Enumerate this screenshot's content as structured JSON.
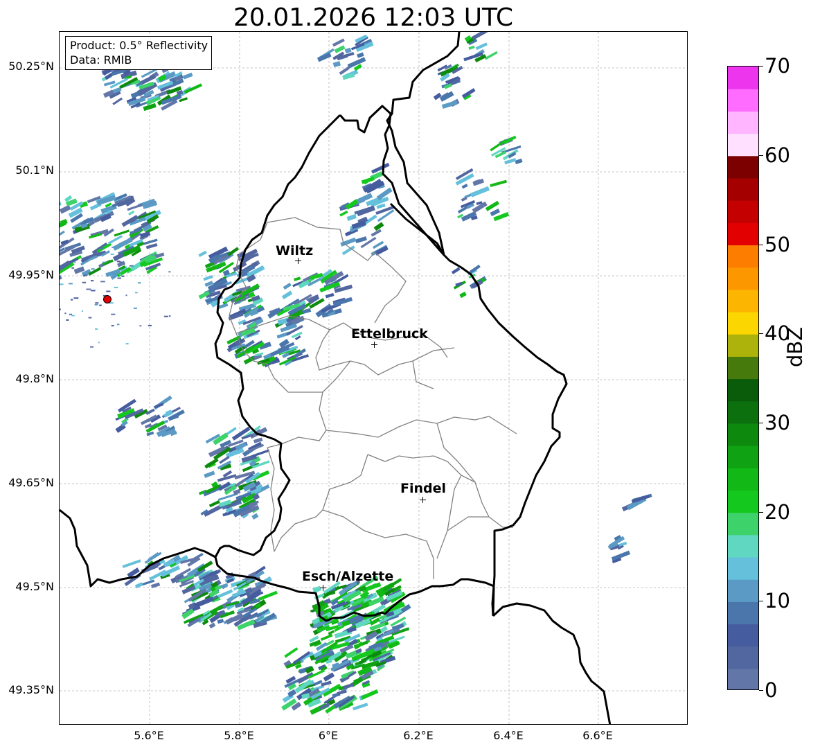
{
  "title": "20.01.2026 12:03 UTC",
  "info_box": {
    "product": "Product: 0.5° Reflectivity",
    "data": "Data: RMIB"
  },
  "map": {
    "lat_ticks": [
      "50.25°N",
      "50.1°N",
      "49.95°N",
      "49.8°N",
      "49.65°N",
      "49.5°N",
      "49.35°N"
    ],
    "lon_ticks": [
      "5.6°E",
      "5.8°E",
      "6°E",
      "6.2°E",
      "6.4°E",
      "6.6°E"
    ],
    "cities": [
      {
        "name": "Wiltz",
        "lon": 5.934,
        "lat": 49.966
      },
      {
        "name": "Ettelbruck",
        "lon": 6.104,
        "lat": 49.847
      },
      {
        "name": "Findel",
        "lon": 6.204,
        "lat": 49.627
      },
      {
        "name": "Esch/Alzette",
        "lon": 5.981,
        "lat": 49.496
      }
    ],
    "radar_site_color": "#e00000",
    "border_color": "#000000",
    "canton_color": "#808080"
  },
  "colorbar": {
    "label": "dBZ",
    "min": 0,
    "max": 70,
    "ticks": [
      "0",
      "10",
      "20",
      "30",
      "40",
      "50",
      "60",
      "70"
    ],
    "colors": [
      "#6376a8",
      "#52669f",
      "#455c9f",
      "#4a76ac",
      "#5a9ac4",
      "#65c0dc",
      "#60d7c1",
      "#3dd36a",
      "#15c81e",
      "#12b815",
      "#0fa212",
      "#0d8a0e",
      "#0c700f",
      "#0a5c0b",
      "#467a0c",
      "#adb30a",
      "#fbd600",
      "#fcb500",
      "#fc9700",
      "#fc7d00",
      "#e30000",
      "#c40000",
      "#a50000",
      "#7d0000",
      "#ffe1ff",
      "#ffb5ff",
      "#ff6cff",
      "#ec35ec"
    ]
  }
}
